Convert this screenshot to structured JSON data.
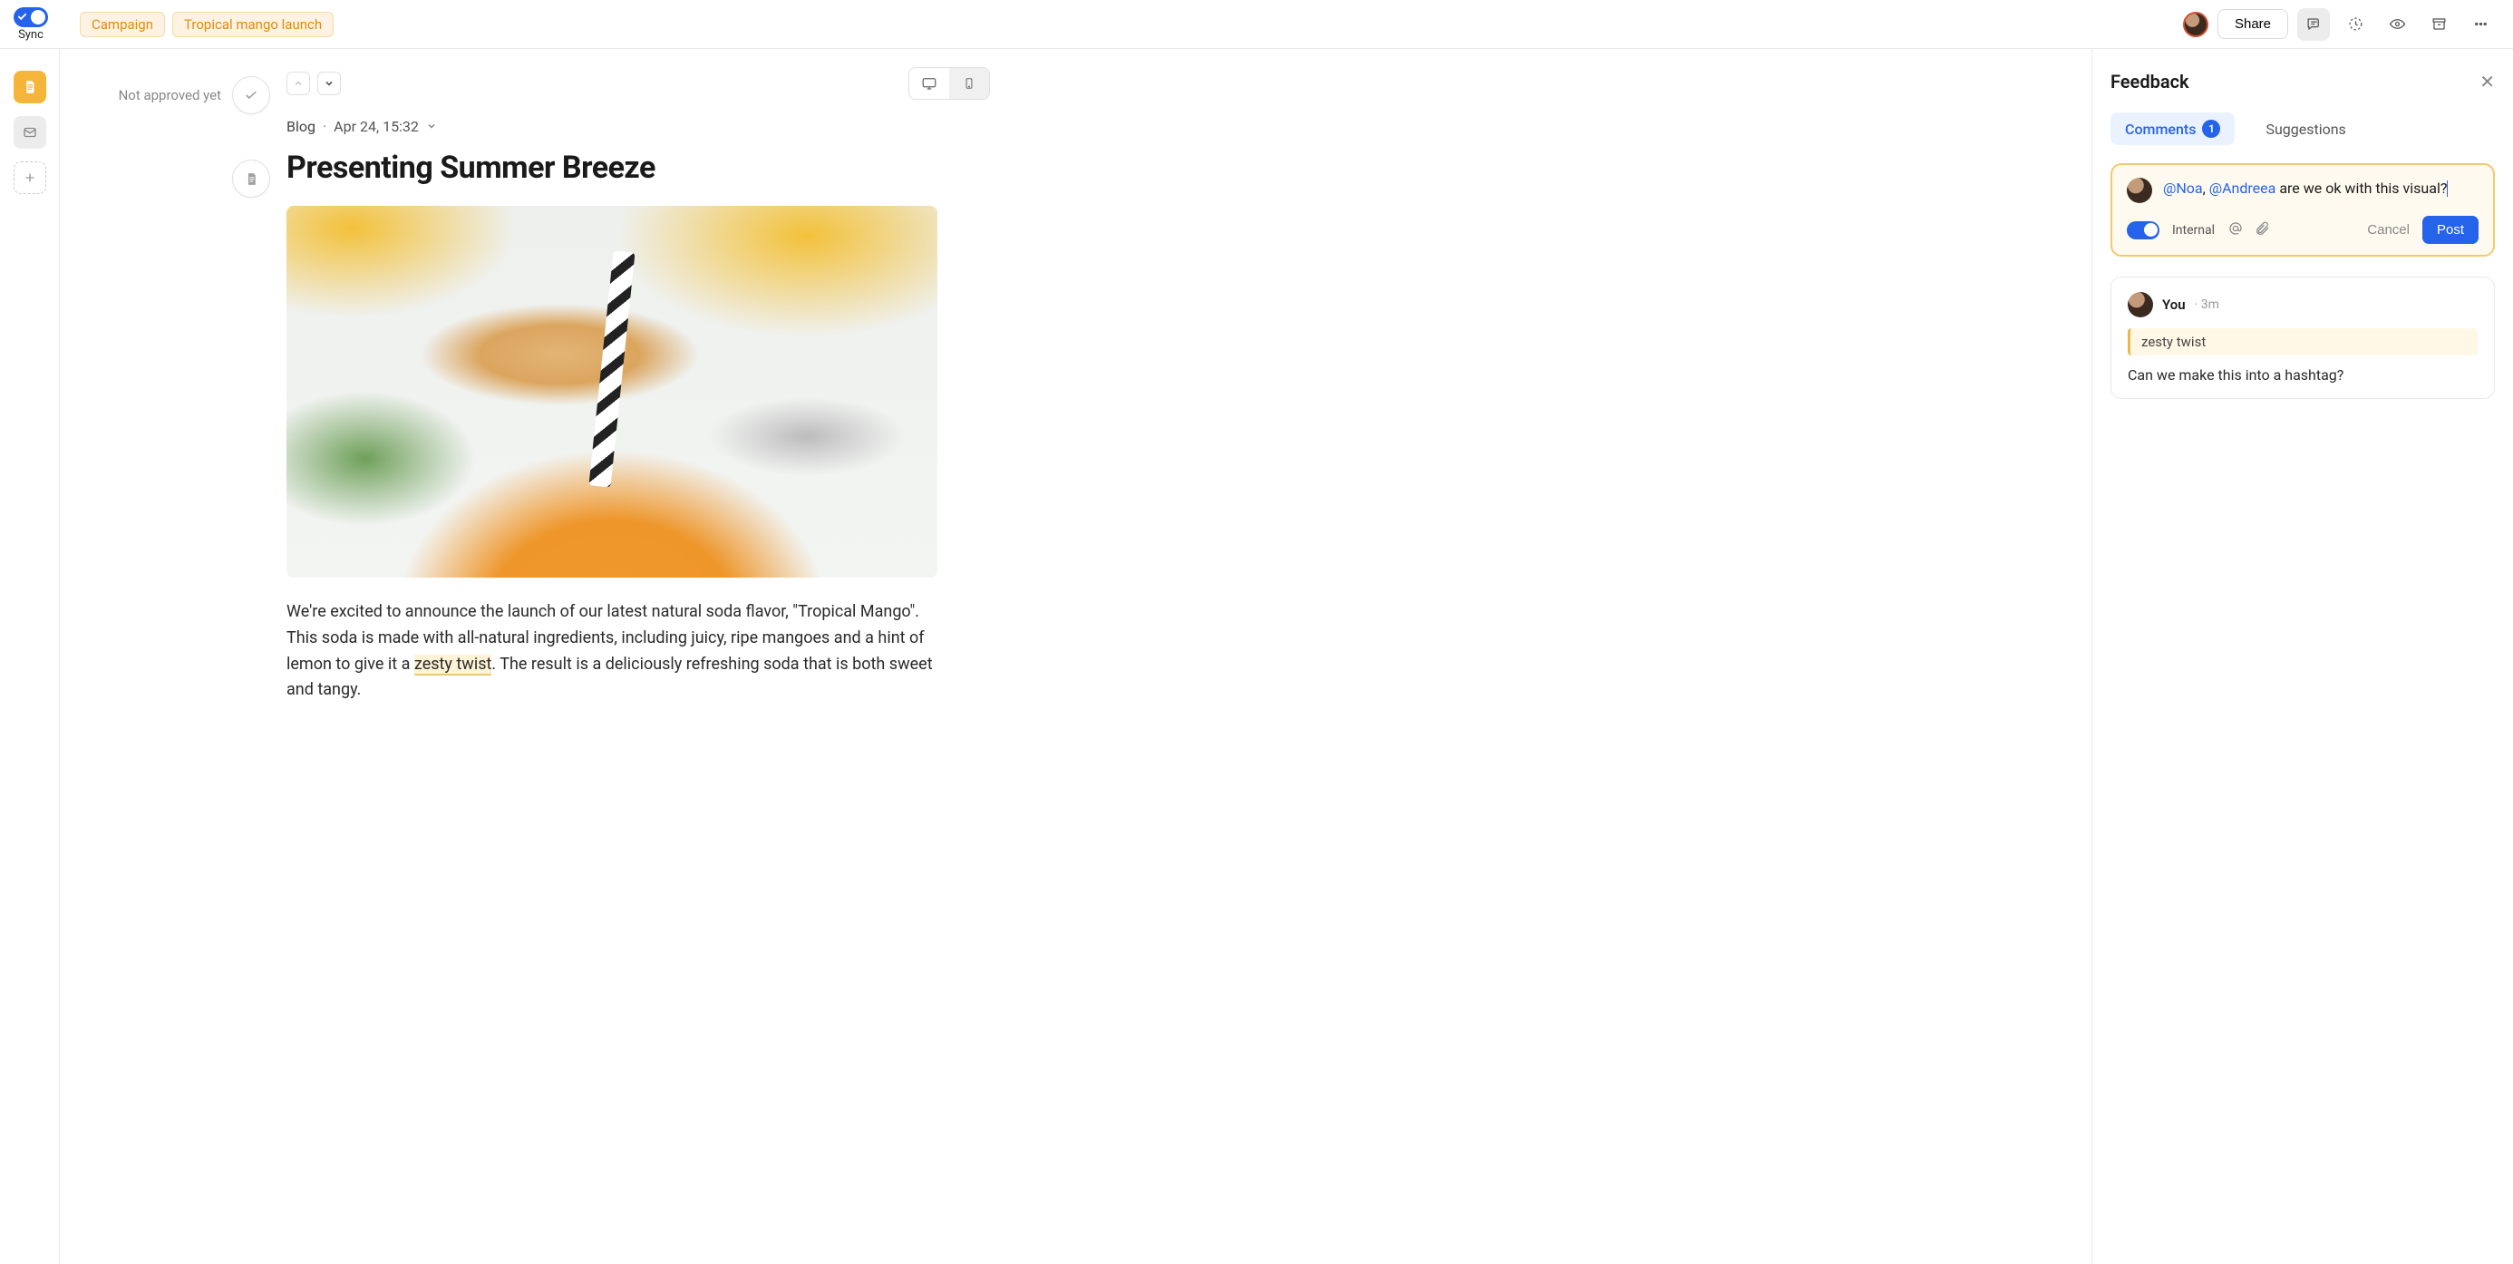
{
  "header": {
    "sync_label": "Sync",
    "tags": [
      "Campaign",
      "Tropical mango launch"
    ],
    "share_label": "Share"
  },
  "approval": {
    "status_text": "Not approved yet"
  },
  "post": {
    "channel": "Blog",
    "date": "Apr 24, 15:32",
    "title": "Presenting Summer Breeze",
    "body_before": "We're excited to announce the launch of our latest natural soda flavor, \"Tropical Mango\". This soda is made with all-natural ingredients, including juicy, ripe mangoes and a hint of lemon to give it a ",
    "highlight": "zesty twist",
    "body_after": ". The result is a deliciously refreshing soda that is both sweet and tangy."
  },
  "panel": {
    "title": "Feedback",
    "tabs": {
      "comments": "Comments",
      "comments_count": "1",
      "suggestions": "Suggestions"
    },
    "composer": {
      "mention1": "@Noa",
      "mention2": "@Andreea",
      "text_rest": " are we ok with this visual?",
      "internal_label": "Internal",
      "cancel": "Cancel",
      "post": "Post"
    },
    "comment": {
      "author": "You",
      "time": "3m",
      "quote": "zesty twist",
      "body": "Can we make this into a hashtag?"
    }
  }
}
